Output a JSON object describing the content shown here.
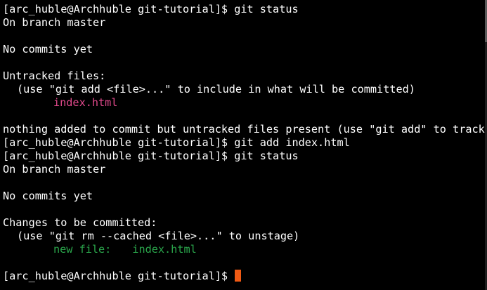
{
  "colors": {
    "background": "#000000",
    "text": "#ffffff",
    "untracked": "#e0498b",
    "staged": "#2aa54b",
    "cursor": "#f05a14"
  },
  "terminal": {
    "prompt1": {
      "prompt": "[arc_huble@Archhuble git-tutorial]$",
      "command": "git status"
    },
    "block1": {
      "branch": "On branch master",
      "no_commits": "No commits yet",
      "untracked_header": "Untracked files:",
      "untracked_hint": "(use \"git add <file>...\" to include in what will be committed)",
      "untracked_file": "index.html",
      "nothing_added": "nothing added to commit but untracked files present (use \"git add\" to track)"
    },
    "prompt2": {
      "prompt": "[arc_huble@Archhuble git-tutorial]$",
      "command": "git add index.html"
    },
    "prompt3": {
      "prompt": "[arc_huble@Archhuble git-tutorial]$",
      "command": "git status"
    },
    "block2": {
      "branch": "On branch master",
      "no_commits": "No commits yet",
      "staged_header": "Changes to be committed:",
      "staged_hint": "(use \"git rm --cached <file>...\" to unstage)",
      "new_file_label": "new file:",
      "new_file_name": "index.html"
    },
    "prompt4": {
      "prompt": "[arc_huble@Archhuble git-tutorial]$",
      "command": ""
    }
  }
}
